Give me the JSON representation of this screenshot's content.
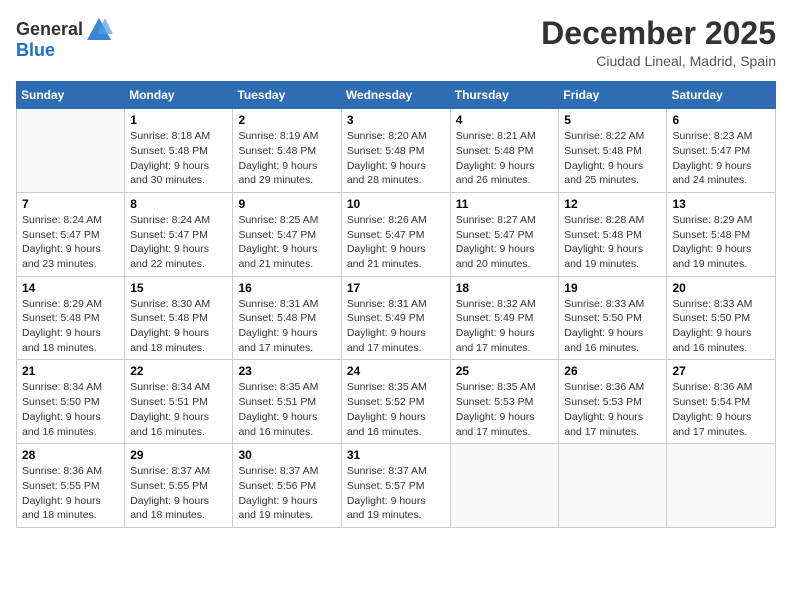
{
  "header": {
    "logo_line1": "General",
    "logo_line2": "Blue",
    "month": "December 2025",
    "location": "Ciudad Lineal, Madrid, Spain"
  },
  "days_of_week": [
    "Sunday",
    "Monday",
    "Tuesday",
    "Wednesday",
    "Thursday",
    "Friday",
    "Saturday"
  ],
  "weeks": [
    [
      {
        "day": "",
        "info": ""
      },
      {
        "day": "1",
        "info": "Sunrise: 8:18 AM\nSunset: 5:48 PM\nDaylight: 9 hours\nand 30 minutes."
      },
      {
        "day": "2",
        "info": "Sunrise: 8:19 AM\nSunset: 5:48 PM\nDaylight: 9 hours\nand 29 minutes."
      },
      {
        "day": "3",
        "info": "Sunrise: 8:20 AM\nSunset: 5:48 PM\nDaylight: 9 hours\nand 28 minutes."
      },
      {
        "day": "4",
        "info": "Sunrise: 8:21 AM\nSunset: 5:48 PM\nDaylight: 9 hours\nand 26 minutes."
      },
      {
        "day": "5",
        "info": "Sunrise: 8:22 AM\nSunset: 5:48 PM\nDaylight: 9 hours\nand 25 minutes."
      },
      {
        "day": "6",
        "info": "Sunrise: 8:23 AM\nSunset: 5:47 PM\nDaylight: 9 hours\nand 24 minutes."
      }
    ],
    [
      {
        "day": "7",
        "info": "Sunrise: 8:24 AM\nSunset: 5:47 PM\nDaylight: 9 hours\nand 23 minutes."
      },
      {
        "day": "8",
        "info": "Sunrise: 8:24 AM\nSunset: 5:47 PM\nDaylight: 9 hours\nand 22 minutes."
      },
      {
        "day": "9",
        "info": "Sunrise: 8:25 AM\nSunset: 5:47 PM\nDaylight: 9 hours\nand 21 minutes."
      },
      {
        "day": "10",
        "info": "Sunrise: 8:26 AM\nSunset: 5:47 PM\nDaylight: 9 hours\nand 21 minutes."
      },
      {
        "day": "11",
        "info": "Sunrise: 8:27 AM\nSunset: 5:47 PM\nDaylight: 9 hours\nand 20 minutes."
      },
      {
        "day": "12",
        "info": "Sunrise: 8:28 AM\nSunset: 5:48 PM\nDaylight: 9 hours\nand 19 minutes."
      },
      {
        "day": "13",
        "info": "Sunrise: 8:29 AM\nSunset: 5:48 PM\nDaylight: 9 hours\nand 19 minutes."
      }
    ],
    [
      {
        "day": "14",
        "info": "Sunrise: 8:29 AM\nSunset: 5:48 PM\nDaylight: 9 hours\nand 18 minutes."
      },
      {
        "day": "15",
        "info": "Sunrise: 8:30 AM\nSunset: 5:48 PM\nDaylight: 9 hours\nand 18 minutes."
      },
      {
        "day": "16",
        "info": "Sunrise: 8:31 AM\nSunset: 5:48 PM\nDaylight: 9 hours\nand 17 minutes."
      },
      {
        "day": "17",
        "info": "Sunrise: 8:31 AM\nSunset: 5:49 PM\nDaylight: 9 hours\nand 17 minutes."
      },
      {
        "day": "18",
        "info": "Sunrise: 8:32 AM\nSunset: 5:49 PM\nDaylight: 9 hours\nand 17 minutes."
      },
      {
        "day": "19",
        "info": "Sunrise: 8:33 AM\nSunset: 5:50 PM\nDaylight: 9 hours\nand 16 minutes."
      },
      {
        "day": "20",
        "info": "Sunrise: 8:33 AM\nSunset: 5:50 PM\nDaylight: 9 hours\nand 16 minutes."
      }
    ],
    [
      {
        "day": "21",
        "info": "Sunrise: 8:34 AM\nSunset: 5:50 PM\nDaylight: 9 hours\nand 16 minutes."
      },
      {
        "day": "22",
        "info": "Sunrise: 8:34 AM\nSunset: 5:51 PM\nDaylight: 9 hours\nand 16 minutes."
      },
      {
        "day": "23",
        "info": "Sunrise: 8:35 AM\nSunset: 5:51 PM\nDaylight: 9 hours\nand 16 minutes."
      },
      {
        "day": "24",
        "info": "Sunrise: 8:35 AM\nSunset: 5:52 PM\nDaylight: 9 hours\nand 16 minutes."
      },
      {
        "day": "25",
        "info": "Sunrise: 8:35 AM\nSunset: 5:53 PM\nDaylight: 9 hours\nand 17 minutes."
      },
      {
        "day": "26",
        "info": "Sunrise: 8:36 AM\nSunset: 5:53 PM\nDaylight: 9 hours\nand 17 minutes."
      },
      {
        "day": "27",
        "info": "Sunrise: 8:36 AM\nSunset: 5:54 PM\nDaylight: 9 hours\nand 17 minutes."
      }
    ],
    [
      {
        "day": "28",
        "info": "Sunrise: 8:36 AM\nSunset: 5:55 PM\nDaylight: 9 hours\nand 18 minutes."
      },
      {
        "day": "29",
        "info": "Sunrise: 8:37 AM\nSunset: 5:55 PM\nDaylight: 9 hours\nand 18 minutes."
      },
      {
        "day": "30",
        "info": "Sunrise: 8:37 AM\nSunset: 5:56 PM\nDaylight: 9 hours\nand 19 minutes."
      },
      {
        "day": "31",
        "info": "Sunrise: 8:37 AM\nSunset: 5:57 PM\nDaylight: 9 hours\nand 19 minutes."
      },
      {
        "day": "",
        "info": ""
      },
      {
        "day": "",
        "info": ""
      },
      {
        "day": "",
        "info": ""
      }
    ]
  ]
}
